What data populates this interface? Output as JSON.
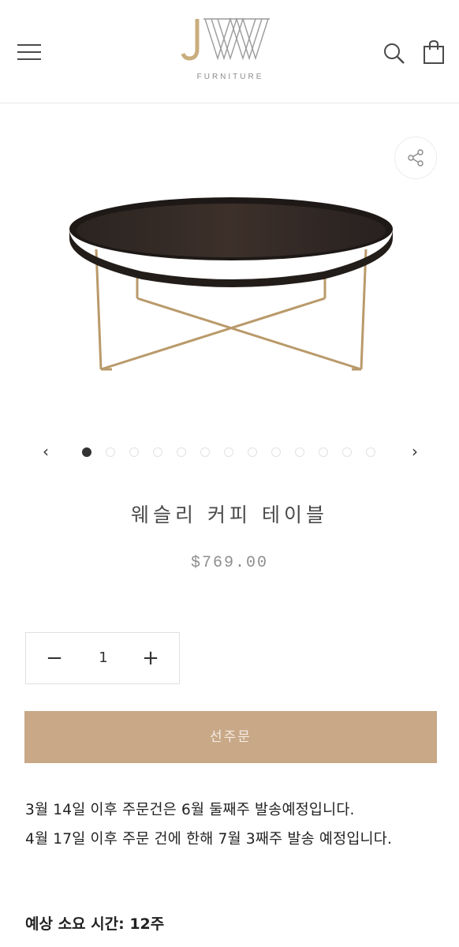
{
  "header": {
    "logo_text": "FURNITURE",
    "menu_icon": "hamburger-menu-icon",
    "search_icon": "search-icon",
    "cart_icon": "shopping-bag-icon"
  },
  "gallery": {
    "share_icon": "share-icon",
    "image_count": 13,
    "active_index": 0
  },
  "product": {
    "title": "웨슬리 커피 테이블",
    "price": "$769.00"
  },
  "quantity": {
    "minus_label": "−",
    "value": "1",
    "plus_label": "+"
  },
  "preorder_button": "선주문",
  "notice": {
    "line1": "3월 14일 이후 주문건은 6월 둘째주 발송예정입니다.",
    "line2": "4월 17일 이후 주문 건에 한해 7월 3째주 발송 예정입니다."
  },
  "lead_time": "예상 소요 시간: 12주",
  "colors": {
    "accent": "#c8a887",
    "logo_gold": "#c9ad7d",
    "text": "#222222"
  }
}
